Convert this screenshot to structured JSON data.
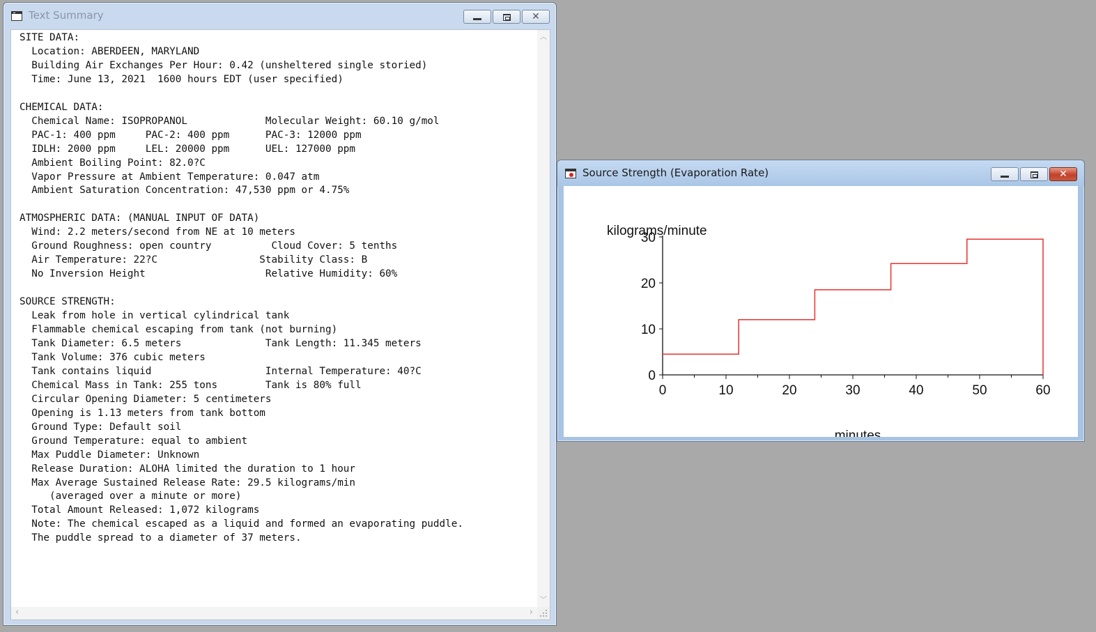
{
  "text_summary": {
    "title": "Text Summary",
    "lines": [
      "SITE DATA:",
      "  Location: ABERDEEN, MARYLAND",
      "  Building Air Exchanges Per Hour: 0.42 (unsheltered single storied)",
      "  Time: June 13, 2021  1600 hours EDT (user specified)",
      "",
      "CHEMICAL DATA:",
      "  Chemical Name: ISOPROPANOL             Molecular Weight: 60.10 g/mol",
      "  PAC-1: 400 ppm     PAC-2: 400 ppm      PAC-3: 12000 ppm",
      "  IDLH: 2000 ppm     LEL: 20000 ppm      UEL: 127000 ppm",
      "  Ambient Boiling Point: 82.0?C",
      "  Vapor Pressure at Ambient Temperature: 0.047 atm",
      "  Ambient Saturation Concentration: 47,530 ppm or 4.75%",
      "",
      "ATMOSPHERIC DATA: (MANUAL INPUT OF DATA)",
      "  Wind: 2.2 meters/second from NE at 10 meters",
      "  Ground Roughness: open country          Cloud Cover: 5 tenths",
      "  Air Temperature: 22?C                 Stability Class: B",
      "  No Inversion Height                    Relative Humidity: 60%",
      "",
      "SOURCE STRENGTH:",
      "  Leak from hole in vertical cylindrical tank",
      "  Flammable chemical escaping from tank (not burning)",
      "  Tank Diameter: 6.5 meters              Tank Length: 11.345 meters",
      "  Tank Volume: 376 cubic meters",
      "  Tank contains liquid                   Internal Temperature: 40?C",
      "  Chemical Mass in Tank: 255 tons        Tank is 80% full",
      "  Circular Opening Diameter: 5 centimeters",
      "  Opening is 1.13 meters from tank bottom",
      "  Ground Type: Default soil",
      "  Ground Temperature: equal to ambient",
      "  Max Puddle Diameter: Unknown",
      "  Release Duration: ALOHA limited the duration to 1 hour",
      "  Max Average Sustained Release Rate: 29.5 kilograms/min",
      "     (averaged over a minute or more)",
      "  Total Amount Released: 1,072 kilograms",
      "  Note: The chemical escaped as a liquid and formed an evaporating puddle.",
      "  The puddle spread to a diameter of 37 meters."
    ]
  },
  "source_strength": {
    "title": "Source Strength (Evaporation Rate)"
  },
  "chart_data": {
    "type": "line",
    "step": true,
    "ylabel": "kilograms/minute",
    "xlabel": "minutes",
    "xlim": [
      0,
      60
    ],
    "ylim": [
      0,
      30
    ],
    "xticks": [
      0,
      10,
      20,
      30,
      40,
      50,
      60
    ],
    "yticks": [
      0,
      10,
      20,
      30
    ],
    "line_color": "#e8322c",
    "series": [
      {
        "x": [
          0,
          12,
          12,
          24,
          24,
          36,
          36,
          48,
          48,
          60,
          60
        ],
        "y": [
          4.5,
          4.5,
          12,
          12,
          18.5,
          18.5,
          24.2,
          24.2,
          29.5,
          29.5,
          0
        ]
      }
    ]
  }
}
